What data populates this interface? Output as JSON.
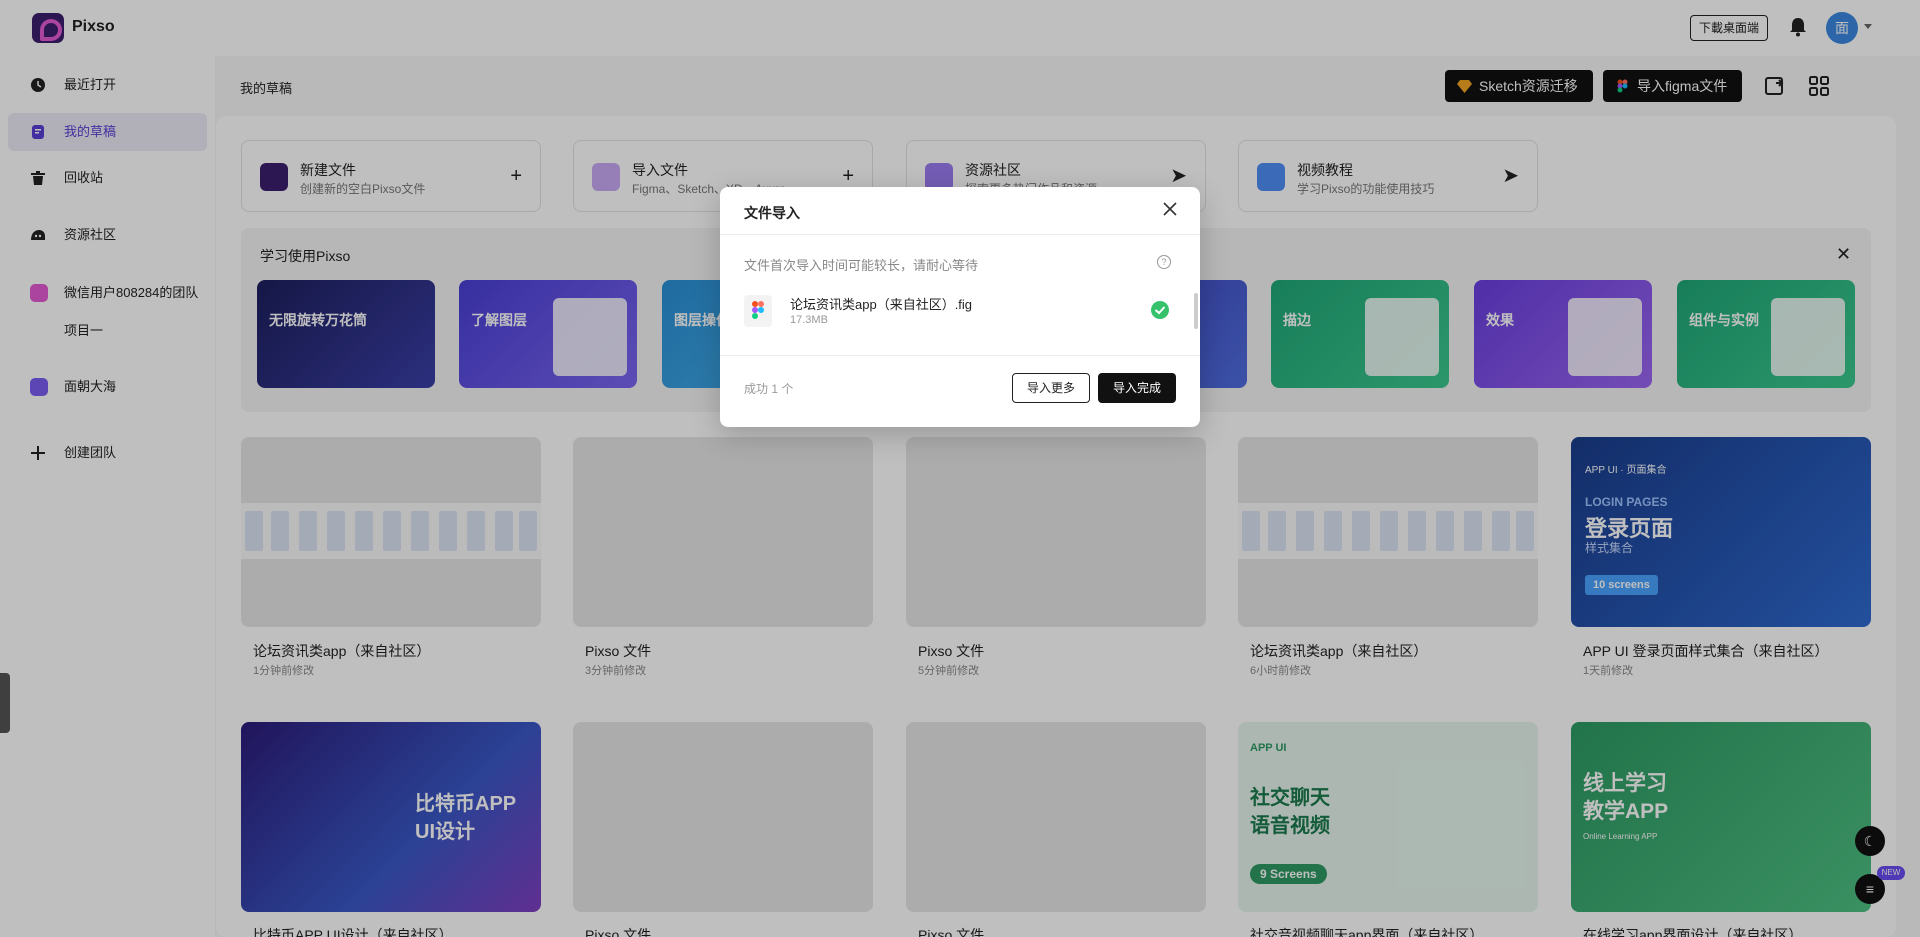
{
  "app": {
    "name": "Pixso"
  },
  "header": {
    "download_label": "下載桌面端",
    "avatar_text": "面"
  },
  "sidebar": {
    "items": [
      {
        "label": "最近打开",
        "icon": "clock-icon"
      },
      {
        "label": "我的草稿",
        "icon": "draft-icon"
      },
      {
        "label": "回收站",
        "icon": "trash-icon"
      },
      {
        "label": "资源社区",
        "icon": "community-icon"
      }
    ],
    "team": {
      "label": "微信用户808284的团队",
      "project": "项目一"
    },
    "team2": {
      "label": "面朝大海"
    },
    "create_team": "创建团队"
  },
  "main": {
    "title": "我的草稿",
    "sketch_button": "Sketch资源迁移",
    "figma_button": "导入figma文件",
    "quick_cards": [
      {
        "title": "新建文件",
        "sub": "创建新的空白Pixso文件",
        "action": "+"
      },
      {
        "title": "导入文件",
        "sub": "Figma、Sketch、XD、Axure",
        "action": "+"
      },
      {
        "title": "资源社区",
        "sub": "探索更多热门作品和资源",
        "action": "➤"
      },
      {
        "title": "视频教程",
        "sub": "学习Pixso的功能使用技巧",
        "action": "➤"
      }
    ],
    "learn": {
      "title": "学习使用Pixso",
      "cards": [
        "无限旋转万花筒",
        "了解图层",
        "图层操作",
        "描边",
        "效果",
        "组件与实例"
      ]
    },
    "files": [
      {
        "name": "论坛资讯类app（来自社区）",
        "time": "1分钟前修改"
      },
      {
        "name": "Pixso 文件",
        "time": "3分钟前修改"
      },
      {
        "name": "Pixso 文件",
        "time": "5分钟前修改"
      },
      {
        "name": "论坛资讯类app（来自社区）",
        "time": "6小时前修改"
      },
      {
        "name": "APP UI 登录页面样式集合（来自社区）",
        "time": "1天前修改"
      },
      {
        "name": "比特币APP UI设计（来自社区）",
        "time": ""
      },
      {
        "name": "Pixso 文件",
        "time": ""
      },
      {
        "name": "Pixso 文件",
        "time": ""
      },
      {
        "name": "社交音视频聊天app界面（来自社区）",
        "time": ""
      },
      {
        "name": "在线学习app界面设计（来自社区）",
        "time": ""
      }
    ],
    "thumbs": {
      "login_heading": "登录页面",
      "login_sub": "LOGIN PAGES",
      "login_tag": "APP UI · 页面集合",
      "login_caption": "样式集合",
      "login_screens": "10 screens",
      "bitcoin": "比特币APP UI设计",
      "social_tag": "APP UI",
      "social": "社交聊天 语音视频",
      "social_screens": "9 Screens",
      "study": "线上学习 教学APP",
      "study_sub": "Online Learning APP"
    },
    "new_badge": "NEW"
  },
  "modal": {
    "title": "文件导入",
    "notice": "文件首次导入时间可能较长，请耐心等待",
    "file": {
      "name": "论坛资讯类app（来自社区）.fig",
      "size": "17.3MB"
    },
    "success": "成功 1 个",
    "more_button": "导入更多",
    "done_button": "导入完成"
  }
}
